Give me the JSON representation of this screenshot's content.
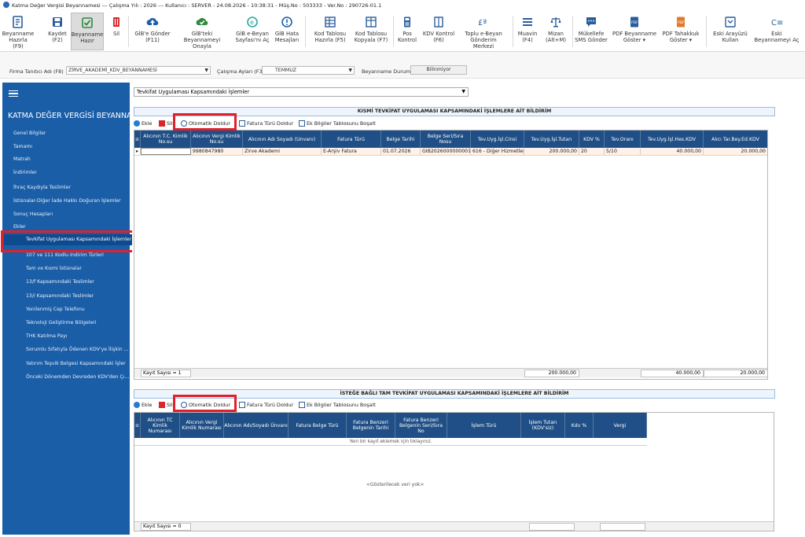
{
  "title": "Katma Değer Vergisi Beyannamesi  ---  Çalışma Yılı : 2026  ---  Kullanıcı : SERVER - 24.08.2026 - 10:38:31 - Müş.No : 503333 - Ver.No : 290726-01.1",
  "ribbon": [
    {
      "l1": "Beyanname",
      "l2": "Hazırla (F9)"
    },
    {
      "l1": "Kaydet",
      "l2": "(F2)"
    },
    {
      "l1": "Beyanname",
      "l2": "Hazır"
    },
    {
      "l1": "Sil",
      "l2": ""
    },
    {
      "l1": "GİB'e Gönder",
      "l2": "(F11)"
    },
    {
      "l1": "GİB'teki",
      "l2": "Beyannameyi Onayla"
    },
    {
      "l1": "GİB e-Beyan",
      "l2": "Sayfası'nı Aç"
    },
    {
      "l1": "GİB Hata",
      "l2": "Mesajları"
    },
    {
      "l1": "Kod Tablosu",
      "l2": "Hazırla (F5)"
    },
    {
      "l1": "Kod Tablosu",
      "l2": "Kopyala (F7)"
    },
    {
      "l1": "Pos",
      "l2": "Kontrol"
    },
    {
      "l1": "KDV Kontrol",
      "l2": "(F6)"
    },
    {
      "l1": "Toplu e-Beyan",
      "l2": "Gönderim Merkezi"
    },
    {
      "l1": "Muavin",
      "l2": "(F4)"
    },
    {
      "l1": "Mizan",
      "l2": "(Alt+M)"
    },
    {
      "l1": "Mükellefe",
      "l2": "SMS Gönder"
    },
    {
      "l1": "PDF Beyanname",
      "l2": "Göster ▾"
    },
    {
      "l1": "PDF Tahakkuk",
      "l2": "Göster ▾"
    },
    {
      "l1": "Eski Arayüzü",
      "l2": "Kullan"
    },
    {
      "l1": "Eski",
      "l2": "Beyannameyi Aç"
    }
  ],
  "filter": {
    "firma_label": "Firma Tanıtıcı Adı (F8)",
    "firma_value": "ZİRVE_AKADEMİ_KDV_BEYANNAMESİ",
    "ay_label": "Çalışma Ayları (F3)",
    "ay_value": "TEMMUZ",
    "durum_label": "Beyanname Durumu",
    "durum_value": "Bilinmiyor"
  },
  "sidebar": {
    "title": "KATMA DEĞER VERGİSİ BEYANNAM...",
    "items": [
      "Genel Bilgiler",
      "Tamamı",
      "Matrah",
      "İndirimler",
      "İhraç Kaydıyla Teslimler",
      "İstisnalar-Diğer İade Hakkı Doğuran İşlemler",
      "Sonuç Hesapları",
      "Ekler",
      "Tevkifat Uygulaması Kapsamındaki İşlemler",
      "107 ve 111 Kodlu İndirim Türleri",
      "Tam ve Kısmi İstisnalar",
      "13/f Kapsamındaki Teslimler",
      "13/i Kapsamındaki Teslimler",
      "Yenilenmiş Cep Telefonu",
      "Teknoloji Geliştirme Bölgeleri",
      "THK Katılma Payı",
      "Sorumlu Sıfatıyla Ödenen KDV'ye İlişkin ...",
      "Yatırım Teşvik Belgesi Kapsamındaki İşler",
      "Önceki Dönemden Devreden KDV'den Çı..."
    ]
  },
  "main": {
    "combo_value": "Tevkifat Uygulaması Kapsamındaki İşlemler",
    "sec1": {
      "title": "KISMİ TEVKİFAT UYGULAMASI KAPSAMINDAKİ İŞLEMLERE AİT BİLDİRİM",
      "toolbar": [
        "Ekle",
        "Sil",
        "Otomatik Doldur",
        "Fatura Türü Doldur",
        "Ek Bilgiler Tablosunu Boşalt"
      ],
      "columns": [
        "Alıcının T.C. Kimlik No.su",
        "Alıcının Vergi Kimlik No.su",
        "Alıcının Adı Soyadı (Unvanı)",
        "Fatura Türü",
        "Belge Tarihi",
        "Belge Seri/Sıra Nosu",
        "Tev.Uyg.İşl.Cinsi",
        "Tev.Uyg.İşl.Tutarı",
        "KDV %",
        "Tev.Oranı",
        "Tev.Uyg.İşl.Hes.KDV",
        "Alıcı Tar.Bey.Ed.KDV"
      ],
      "row": [
        "",
        "9980847980",
        "Zirve Akademi",
        "E-Arşiv Fatura",
        "01.07.2026",
        "GIB2026000000001",
        "616 - Diğer Hizmetler [",
        "200.000,00",
        "20",
        "5/10",
        "40.000,00",
        "20.000,00"
      ],
      "footer": {
        "count": "Kayıt Sayısı = 1",
        "sum_tutar": "200.000,00",
        "sum_kdv": "40.000,00",
        "sum_alici": "20.000,00"
      }
    },
    "sec2": {
      "title": "İSTEĞE BAĞLI TAM TEVKİFAT UYGULAMASI KAPSAMINDAKİ İŞLEMLERE AİT BİLDİRİM",
      "toolbar": [
        "Ekle",
        "Sil",
        "Otomatik Doldur",
        "Fatura Türü Doldur",
        "Ek Bilgiler Tablosunu Boşalt"
      ],
      "columns": [
        "Alıcının TC Kimlik Numarası",
        "Alıcının Vergi Kimlik Numarası",
        "Alıcının Adı/Soyadı Ünvanı",
        "Fatura Belge Türü",
        "Fatura Benzeri Belgenin Tarihi",
        "Fatura Benzeri Belgenin Seri/Sıra No",
        "İşlem Türü",
        "İşlem Tutarı (KDV'siz)",
        "Kdv %",
        "Vergi"
      ],
      "new_row": "Yeni bir kayıt eklemek için tıklayınız.",
      "empty": "<Gösterilecek veri yok>",
      "footer": {
        "count": "Kayıt Sayısı = 0"
      }
    }
  },
  "colors": {
    "sidebar": "#1a5ea8",
    "grid_header": "#1f4f86",
    "highlight": "#e0202a"
  }
}
